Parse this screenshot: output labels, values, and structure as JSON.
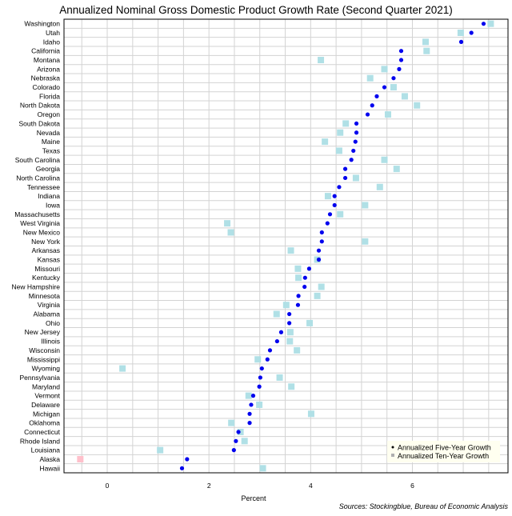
{
  "chart_data": {
    "type": "scatter",
    "title": "Annualized Nominal Gross Domestic Product Growth Rate (Second Quarter 2021)",
    "xlabel": "Percent",
    "ylabel": "",
    "xlim": [
      -0.85,
      7.88
    ],
    "xticks": [
      0,
      2,
      4,
      6
    ],
    "grid": true,
    "legend_position": "bottom-right",
    "source": "Sources: Stockingblue, Bureau of Economic Analysis",
    "colors": {
      "five_year": "#0000ee",
      "ten_year": "#b0e0e6",
      "ten_year_negative": "#ffc0cb"
    },
    "categories": [
      "Washington",
      "Utah",
      "Idaho",
      "California",
      "Montana",
      "Arizona",
      "Nebraska",
      "Colorado",
      "Florida",
      "North Dakota",
      "Oregon",
      "South Dakota",
      "Nevada",
      "Maine",
      "Texas",
      "South Carolina",
      "Georgia",
      "North Carolina",
      "Tennessee",
      "Indiana",
      "Iowa",
      "Massachusetts",
      "West Virginia",
      "New Mexico",
      "New York",
      "Arkansas",
      "Kansas",
      "Missouri",
      "Kentucky",
      "New Hampshire",
      "Minnesota",
      "Virginia",
      "Alabama",
      "Ohio",
      "New Jersey",
      "Illinois",
      "Wisconsin",
      "Mississippi",
      "Wyoming",
      "Pennsylvania",
      "Maryland",
      "Vermont",
      "Delaware",
      "Michigan",
      "Oklahoma",
      "Connecticut",
      "Rhode Island",
      "Louisiana",
      "Alaska",
      "Hawaii"
    ],
    "series": [
      {
        "name": "Annualized Five-Year Growth",
        "marker": "dot",
        "values": [
          7.4,
          7.16,
          6.96,
          5.78,
          5.78,
          5.74,
          5.63,
          5.45,
          5.3,
          5.21,
          5.12,
          4.9,
          4.9,
          4.88,
          4.84,
          4.8,
          4.68,
          4.68,
          4.56,
          4.47,
          4.47,
          4.38,
          4.33,
          4.22,
          4.22,
          4.16,
          4.16,
          3.97,
          3.89,
          3.88,
          3.76,
          3.75,
          3.58,
          3.58,
          3.42,
          3.34,
          3.2,
          3.15,
          3.04,
          3.01,
          2.99,
          2.87,
          2.83,
          2.8,
          2.8,
          2.58,
          2.53,
          2.49,
          1.57,
          1.47
        ]
      },
      {
        "name": "Annualized Ten-Year Growth",
        "marker": "square",
        "values": [
          7.54,
          6.95,
          6.26,
          6.28,
          4.2,
          5.45,
          5.17,
          5.63,
          5.85,
          6.09,
          5.52,
          4.69,
          4.58,
          4.28,
          4.56,
          5.45,
          5.69,
          4.89,
          5.36,
          4.34,
          5.07,
          4.58,
          2.36,
          2.43,
          5.07,
          3.61,
          4.13,
          3.75,
          3.76,
          4.21,
          4.13,
          3.52,
          3.33,
          3.98,
          3.6,
          3.59,
          3.73,
          2.96,
          0.3,
          3.39,
          3.62,
          2.78,
          2.99,
          4.01,
          2.44,
          2.62,
          2.7,
          1.04,
          -0.53,
          3.06
        ]
      }
    ]
  }
}
